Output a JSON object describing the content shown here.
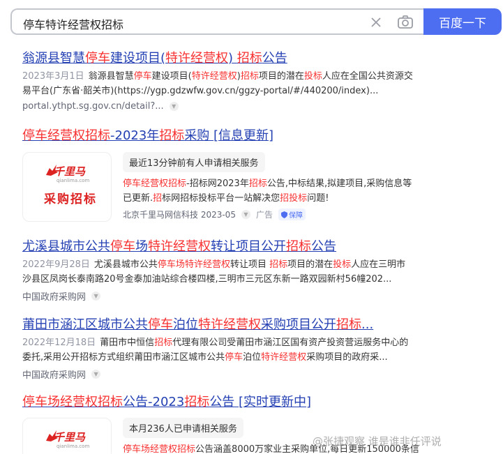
{
  "search": {
    "query": "停车特许经营权招标",
    "button_label": "百度一下"
  },
  "results": [
    {
      "title_parts": [
        "翁源县智慧",
        "停车",
        "建设项目(",
        "特许经营权",
        ") ",
        "招标",
        "公告"
      ],
      "abstract_date": "2023年3月1日",
      "abstract_parts": [
        "翁源县智慧",
        "停车",
        "建设项目(",
        "特许经营权",
        ")",
        "招标",
        "项目的潜在",
        "投标",
        "人应在全国公共资源交易平台(广东省·韶关市)(https://ygp.gdzwfw.gov.cn/ggzy-portal/#/440200/index)..."
      ],
      "source": "portal.ythpt.sg.gov.cn/detail?..."
    },
    {
      "title_parts": [
        "尤溪县城市公共",
        "停车",
        "场",
        "特许经营权",
        "转让项目公开",
        "招标",
        "公告"
      ],
      "abstract_date": "2022年9月28日",
      "abstract_parts": [
        "尤溪县城市公共",
        "停车场",
        "特许经营权",
        "转让项目 ",
        "招标",
        "项目的潜在",
        "投标",
        "人应在三明市沙县区凤岗长泰南路20号金泰加油站综合楼四楼,三明市三元区东新一路双园新村56幢202..."
      ],
      "source": "中国政府采购网"
    },
    {
      "title_parts": [
        "莆田市涵江区城市公共",
        "停车",
        "泊位",
        "特许经营权",
        "采购项目公开",
        "招标",
        "..."
      ],
      "abstract_date": "2022年12月18日",
      "abstract_parts": [
        "莆田市中恒信",
        "招标",
        "代理有限公司受莆田市涵江区国有资产投资营运服务中心的委托,采用公开招标方式组织莆田市涵江区城市公共",
        "停车",
        "泊位",
        "特许经营权",
        "采购项目的政府采..."
      ],
      "source": "中国政府采购网"
    }
  ],
  "ads": [
    {
      "title_parts": [
        "停车",
        "经营权",
        "招标",
        "-2023年",
        "招标",
        "采购 [信息更新]"
      ],
      "logo_brand": "千里马",
      "logo_brand_sub": "qianlima.com",
      "logo_caption": "采购招标",
      "tag": "最近13分钟前有人申请相关服务",
      "abstract_parts": [
        "停车",
        "经营权",
        "招标",
        "-招标网2023年",
        "招标",
        "公告,中标结果,拟建项目,采购信息等已更新.",
        "招",
        "标网招标投标平台一站解决您",
        "招投标",
        "问题!"
      ],
      "advertiser": "北京千里马网信科技 2023-05",
      "ad_label": "广告",
      "badge": "保障"
    },
    {
      "title_parts": [
        "停车场",
        "经营权",
        "招标",
        "公告-2023",
        "招标",
        "公告 [实时更新中]"
      ],
      "logo_brand": "千里马",
      "logo_brand_sub": "qianlima.com",
      "logo_caption": "",
      "tag": "本月236人已申请相关服务",
      "abstract_parts": [
        "停车场",
        "经营权",
        "招标",
        "公告涵盖8000万家业主采购单位,每日更新150000条信"
      ]
    }
  ],
  "watermark": "@张捷观察 谁是谁非任评说"
}
